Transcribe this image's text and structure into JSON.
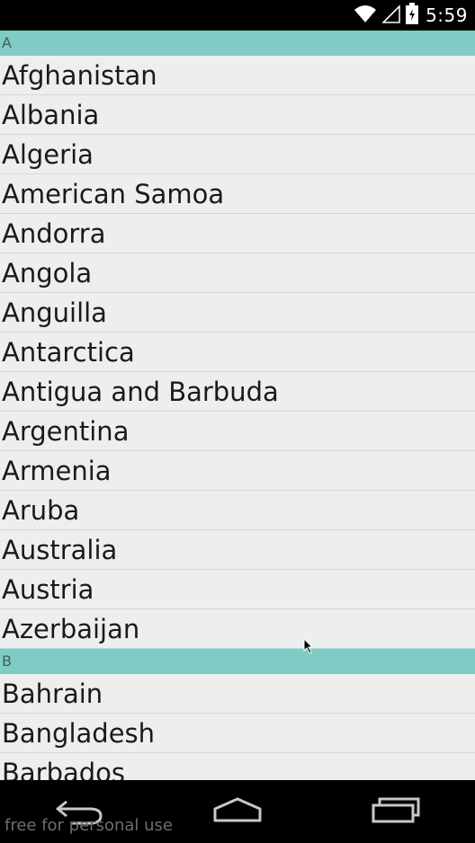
{
  "status_bar": {
    "time": "5:59",
    "icons": [
      "wifi-icon",
      "signal-icon",
      "battery-icon"
    ]
  },
  "sections": [
    {
      "header": "A",
      "items": [
        "Afghanistan",
        "Albania",
        "Algeria",
        "American Samoa",
        "Andorra",
        "Angola",
        "Anguilla",
        "Antarctica",
        "Antigua and Barbuda",
        "Argentina",
        "Armenia",
        "Aruba",
        "Australia",
        "Austria",
        "Azerbaijan"
      ]
    },
    {
      "header": "B",
      "items": [
        "Bahrain",
        "Bangladesh",
        "Barbados"
      ]
    }
  ],
  "nav_bar": {
    "buttons": [
      "back-icon",
      "home-icon",
      "recents-icon"
    ]
  },
  "watermark": "free for personal use",
  "colors": {
    "section_header_bg": "#80cbc4",
    "list_bg": "#eeeeee",
    "divider": "#d6d6d6"
  }
}
